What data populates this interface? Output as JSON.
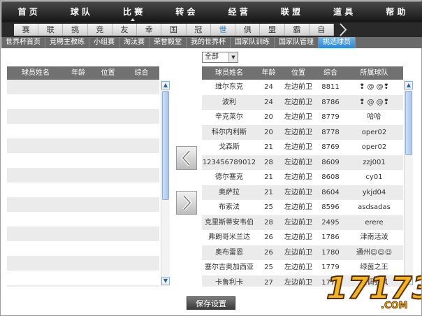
{
  "top_nav": [
    "首 页",
    "球 队",
    "比 赛",
    "转 会",
    "经 营",
    "联 盟",
    "道 具",
    "帮 助"
  ],
  "sub_nav": [
    "赛",
    "联",
    "挑",
    "竞",
    "友",
    "幸",
    "国",
    "冠",
    "世",
    "俱",
    "盟",
    "霸",
    "自"
  ],
  "tabs": [
    "世界杯首页",
    "竞聘主教练",
    "小组赛",
    "淘汰赛",
    "荣誉殿堂",
    "我的世界杯",
    "国家队训练",
    "国家队管理",
    "挑选球员"
  ],
  "filter": {
    "value": "全部"
  },
  "left_table": {
    "columns": [
      "球员姓名",
      "年龄",
      "位置",
      "综合"
    ]
  },
  "right_table": {
    "columns": [
      "球员姓名",
      "年龄",
      "位置",
      "综合",
      "所属球队"
    ],
    "rows": [
      [
        "维尔东克",
        "24",
        "左边前卫",
        "8811",
        "❢ @ @❢"
      ],
      [
        "波利",
        "24",
        "左边前卫",
        "8786",
        "❢ @ @❢"
      ],
      [
        "辛克莱尔",
        "20",
        "左边前卫",
        "8779",
        "哈哈"
      ],
      [
        "科尔内利斯",
        "20",
        "左边前卫",
        "8778",
        "oper02"
      ],
      [
        "戈森斯",
        "21",
        "左边前卫",
        "8769",
        "oper02"
      ],
      [
        "123456789012",
        "28",
        "左边前卫",
        "8609",
        "zzj001"
      ],
      [
        "德尔塞克",
        "21",
        "左边前卫",
        "8608",
        "cy01"
      ],
      [
        "奥萨拉",
        "21",
        "左边前卫",
        "8604",
        "ykjd04"
      ],
      [
        "布索法",
        "25",
        "左边前卫",
        "8596",
        "asdsadas"
      ],
      [
        "克里斯蒂安韦伯",
        "28",
        "左边前卫",
        "2495",
        "erere"
      ],
      [
        "弗朗哥米兰达",
        "26",
        "左边前卫",
        "1786",
        "津南活泼"
      ],
      [
        "奥布雷恩",
        "26",
        "左边前卫",
        "1780",
        "通州☺☺☺"
      ],
      [
        "塞尔吉奥加西亚",
        "25",
        "左边前卫",
        "1779",
        "绿茵之王"
      ],
      [
        "卡鲁利卡",
        "27",
        "左边前卫",
        "1775",
        "蓝调狂风"
      ]
    ]
  },
  "save_label": "保存设置",
  "logo": {
    "text": "17173",
    "suffix": ".COM"
  }
}
